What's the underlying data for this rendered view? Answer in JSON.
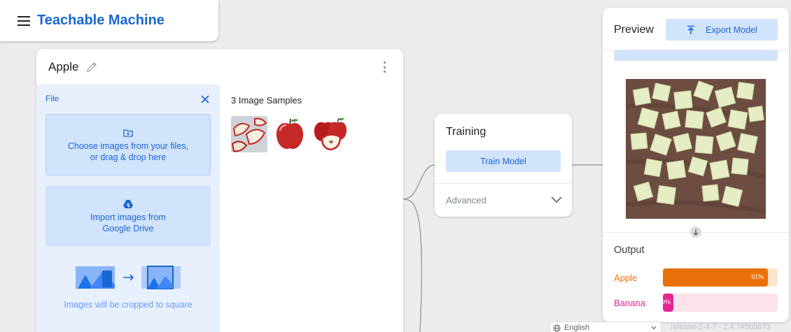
{
  "header": {
    "app_title": "Teachable Machine"
  },
  "class_card": {
    "name": "Apple",
    "upload_panel": {
      "label": "File",
      "choose_text_line1": "Choose images from your files,",
      "choose_text_line2": "or drag & drop here",
      "drive_text_line1": "Import images from",
      "drive_text_line2": "Google Drive",
      "crop_note": "Images will be cropped to square"
    },
    "samples_title": "3 Image Samples"
  },
  "training": {
    "title": "Training",
    "train_button": "Train Model",
    "advanced_label": "Advanced"
  },
  "preview": {
    "title": "Preview",
    "export_button": "Export Model",
    "output_title": "Output",
    "outputs": [
      {
        "label": "Apple",
        "value_text": "91%",
        "value": 0.91,
        "color": "#e8710a",
        "track_color": "#fde4c8"
      },
      {
        "label": "Banana",
        "value_text": "9%",
        "value": 0.09,
        "color": "#e52592",
        "track_color": "#fde2ea"
      }
    ]
  },
  "footer": {
    "language": "English",
    "release": "release-2-4-7 - 2.4.7#5b5b73"
  },
  "colors": {
    "accent": "#1967d2",
    "accent_light": "#d2e3fc",
    "panel_bg": "#e8f0fe"
  }
}
